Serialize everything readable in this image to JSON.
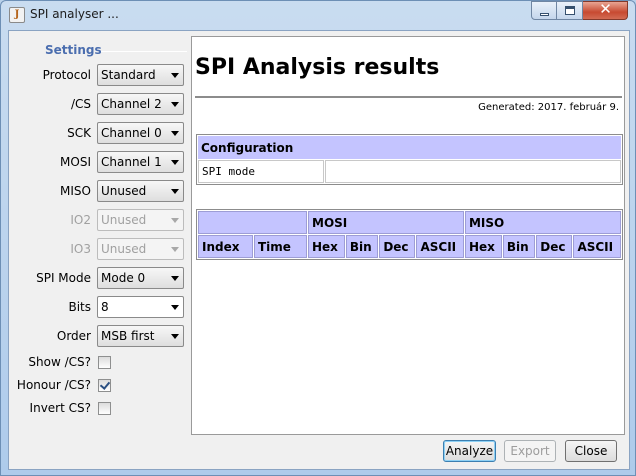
{
  "window": {
    "title": "SPI analyser ...",
    "controls": {
      "minimize": "_",
      "maximize": "□",
      "close": "✕"
    }
  },
  "settings": {
    "title": "Settings",
    "fields": [
      {
        "label": "Protocol",
        "value": "Standard",
        "disabled": false
      },
      {
        "label": "/CS",
        "value": "Channel 2",
        "disabled": false
      },
      {
        "label": "SCK",
        "value": "Channel 0",
        "disabled": false
      },
      {
        "label": "MOSI",
        "value": "Channel 1",
        "disabled": false
      },
      {
        "label": "MISO",
        "value": "Unused",
        "disabled": false
      },
      {
        "label": "IO2",
        "value": "Unused",
        "disabled": true
      },
      {
        "label": "IO3",
        "value": "Unused",
        "disabled": true
      },
      {
        "label": "SPI Mode",
        "value": "Mode 0",
        "disabled": false
      },
      {
        "label": "Bits",
        "value": "8",
        "disabled": false
      },
      {
        "label": "Order",
        "value": "MSB first",
        "disabled": false
      }
    ],
    "checks": [
      {
        "label": "Show /CS?",
        "checked": false
      },
      {
        "label": "Honour /CS?",
        "checked": true
      },
      {
        "label": "Invert CS?",
        "checked": false
      }
    ]
  },
  "report": {
    "title": "SPI Analysis results",
    "generated": "Generated: 2017. február 9.",
    "config": {
      "header": "Configuration",
      "rows": [
        {
          "key": "SPI mode",
          "value": ""
        }
      ]
    },
    "data": {
      "groups": [
        "",
        "MOSI",
        "MISO"
      ],
      "columns": [
        "Index",
        "Time",
        "Hex",
        "Bin",
        "Dec",
        "ASCII",
        "Hex",
        "Bin",
        "Dec",
        "ASCII"
      ]
    }
  },
  "buttons": {
    "analyze": "Analyze",
    "export": "Export",
    "close": "Close"
  }
}
